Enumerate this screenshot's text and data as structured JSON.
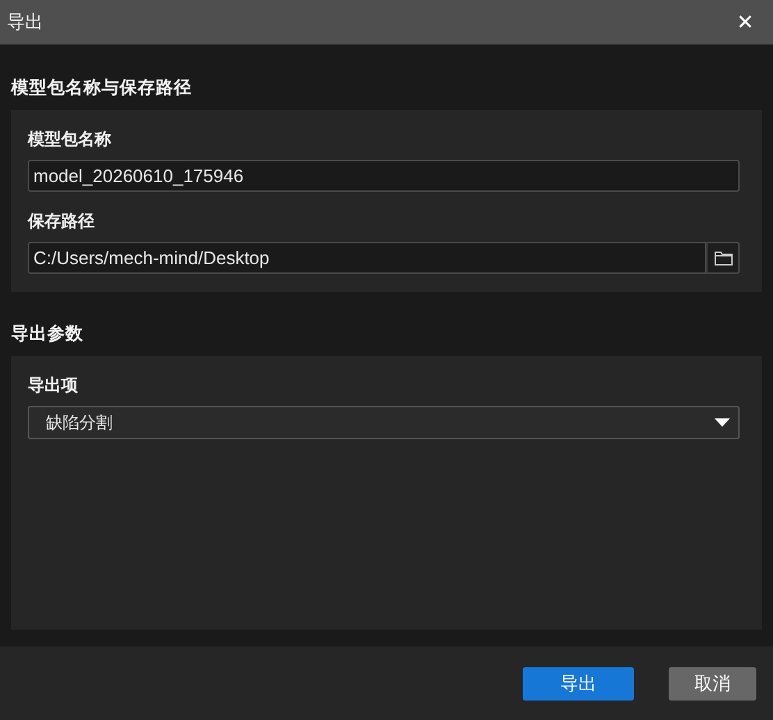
{
  "window": {
    "title": "导出",
    "close": "✕"
  },
  "sections": [
    {
      "title": "模型包名称与保存路径",
      "fields": [
        {
          "kind": "text",
          "label": "模型包名称",
          "value": "model_20260610_175946"
        },
        {
          "kind": "path",
          "label": "保存路径",
          "value": "C:/Users/mech-mind/Desktop"
        }
      ]
    },
    {
      "title": "导出参数",
      "fields": [
        {
          "kind": "select",
          "label": "导出项",
          "value": "缺陷分割"
        }
      ]
    }
  ],
  "buttons": [
    {
      "label": "导出",
      "kind": "primary"
    },
    {
      "label": "取消",
      "kind": "secondary"
    }
  ]
}
